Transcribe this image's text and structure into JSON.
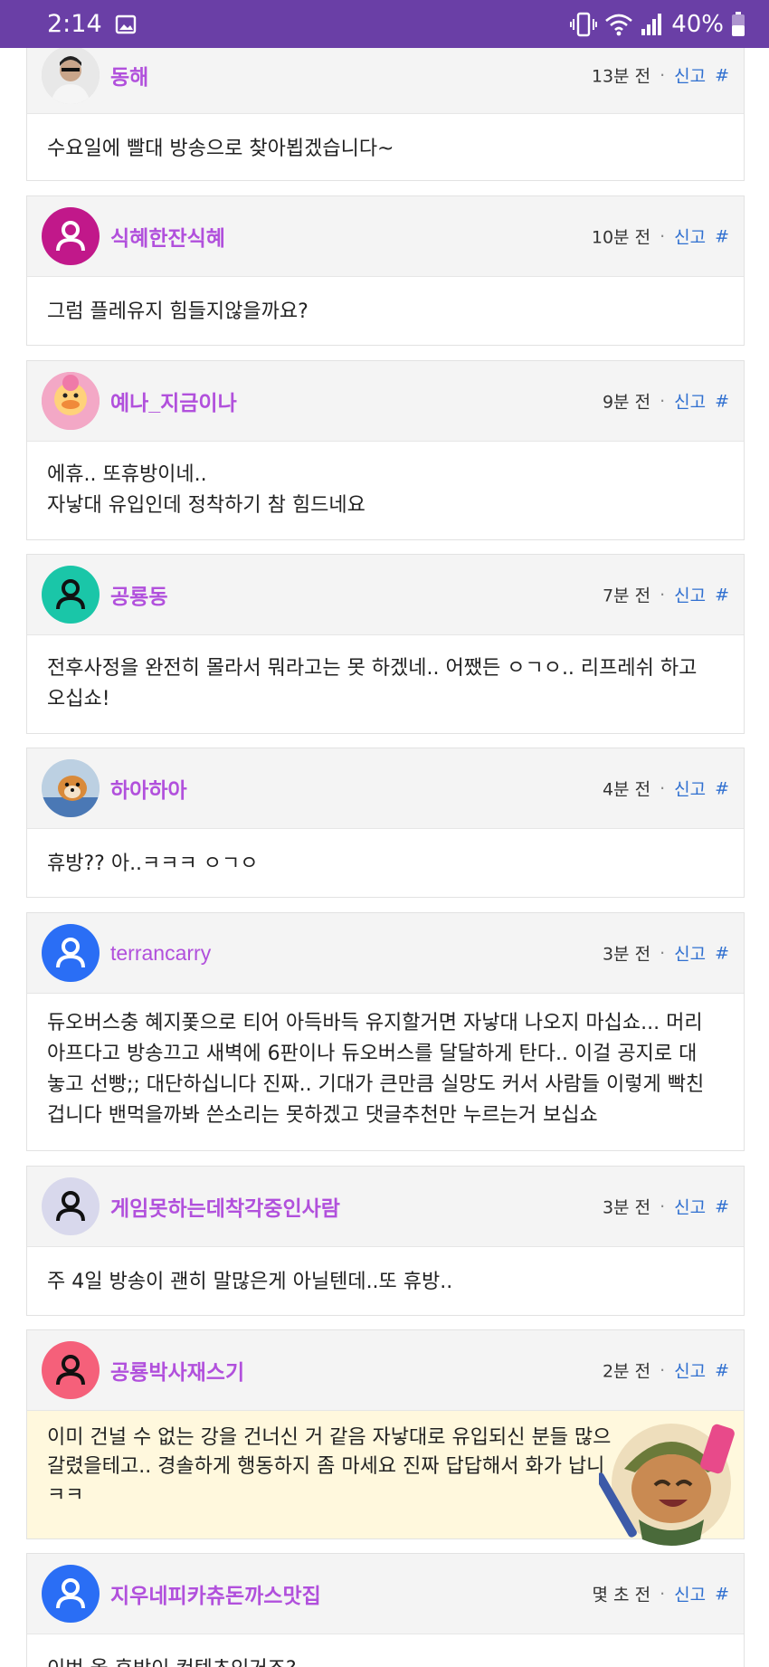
{
  "status_bar": {
    "time": "2:14",
    "battery": "40%",
    "icons": [
      "image-icon",
      "vibrate-icon",
      "wifi-icon",
      "signal-icon",
      "battery-icon"
    ]
  },
  "meta": {
    "separator": "·",
    "report_label": "신고",
    "anchor_label": "#"
  },
  "comments": [
    {
      "nickname": "동해",
      "time": "13분 전",
      "text": [
        "수요일에 빨대 방송으로 찾아뵙겠습니다~"
      ],
      "avatar": "photo-man",
      "avatar_color": "#dcdcdc"
    },
    {
      "nickname": "식혜한잔식혜",
      "time": "10분 전",
      "text": [
        "그럼 플레유지 힘들지않을까요?"
      ],
      "avatar": "default-user-white",
      "avatar_color": "#c1188a"
    },
    {
      "nickname": "예나_지금이나",
      "time": "9분 전",
      "text": [
        "에휴.. 또휴방이네..",
        "자낳대 유입인데 정착하기 참 힘드네요"
      ],
      "avatar": "photo-pink-duck",
      "avatar_color": "#f0a0c0"
    },
    {
      "nickname": "공룡동",
      "time": "7분 전",
      "text": [
        "전후사정을 완전히 몰라서 뭐라고는 못 하겠네.. 어쨌든 ㅇㄱㅇ.. 리프레쉬 하고",
        "오십쇼!"
      ],
      "avatar": "default-user-black",
      "avatar_color": "#1ac6a8"
    },
    {
      "nickname": "하아하아",
      "time": "4분 전",
      "text": [
        "휴방?? 아..ㅋㅋㅋ ㅇㄱㅇ"
      ],
      "avatar": "photo-dog",
      "avatar_color": "#c9d6e3"
    },
    {
      "nickname": "terrancarry",
      "time": "3분 전",
      "text": [
        "듀오버스충 혜지퐃으로 티어 아득바득 유지할거면 자낳대 나오지 마십쇼... 머리",
        "아프다고 방송끄고 새벽에 6판이나 듀오버스를 달달하게 탄다.. 이걸 공지로 대",
        "놓고 선빵;; 대단하십니다 진짜.. 기대가 큰만큼 실망도 커서 사람들 이렇게 빡친",
        "겁니다 밴먹을까봐 쓴소리는 못하겠고 댓글추천만 누르는거 보십쇼"
      ],
      "avatar": "default-user-white",
      "avatar_color": "#2a6ef5"
    },
    {
      "nickname": "게임못하는데착각중인사람",
      "time": "3분 전",
      "text": [
        "주 4일 방송이 괜히 말많은게 아닐텐데..또 휴방.."
      ],
      "avatar": "default-user-black",
      "avatar_color": "#d8d8ec"
    },
    {
      "nickname": "공룡박사재스기",
      "time": "2분 전",
      "text": [
        "이미 건널 수 없는 강을 건너신 거 같음 자낳대로 유입되신 분들 많으",
        "갈렸을테고.. 경솔하게 행동하지 좀 마세요 진짜 답답해서 화가 납니",
        "ㅋㅋ"
      ],
      "avatar": "default-user-black",
      "avatar_color": "#f5607a",
      "highlight": true
    },
    {
      "nickname": "지우네피카츄돈까스맛집",
      "time": "몇 초 전",
      "text": [
        "이번 올 휴방이 컨텐츠인거죠?"
      ],
      "avatar": "default-user-white",
      "avatar_color": "#2a6ef5"
    }
  ]
}
